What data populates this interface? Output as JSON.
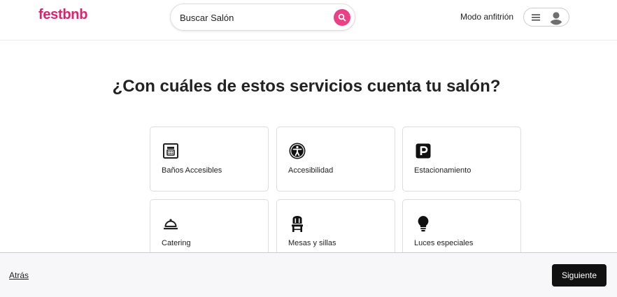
{
  "header": {
    "logo": "festbnb",
    "search": {
      "placeholder": "Buscar Salón"
    },
    "host_mode_label": "Modo anfitrión"
  },
  "page": {
    "title": "¿Con cuáles de estos servicios cuenta tu salón?"
  },
  "services": [
    {
      "label": "Baños Accesibles",
      "icon": "accessible-restroom-icon"
    },
    {
      "label": "Accesibilidad",
      "icon": "accessibility-icon"
    },
    {
      "label": "Estacionamiento",
      "icon": "parking-icon"
    },
    {
      "label": "Catering",
      "icon": "catering-bell-icon"
    },
    {
      "label": "Mesas y sillas",
      "icon": "chair-icon"
    },
    {
      "label": "Luces especiales",
      "icon": "lightbulb-icon"
    }
  ],
  "footer": {
    "back_label": "Atrás",
    "next_label": "Siguiente"
  },
  "colors": {
    "brand": "#e0206b",
    "search_button": "#ec3f86",
    "primary_button": "#111111"
  }
}
